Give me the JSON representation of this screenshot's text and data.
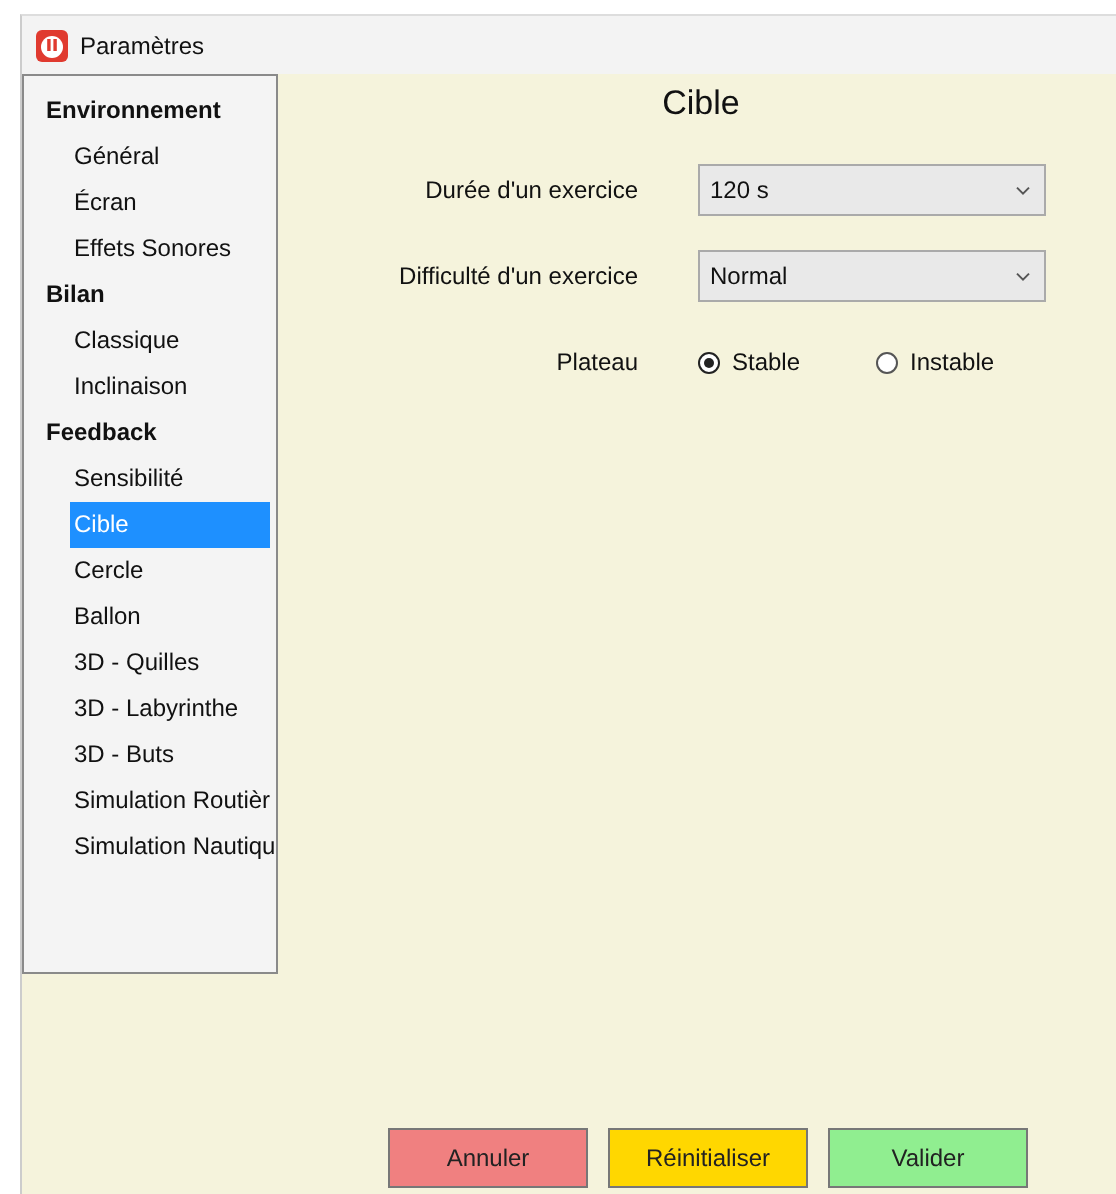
{
  "window": {
    "title": "Paramètres"
  },
  "sidebar": {
    "groups": [
      {
        "label": "Environnement",
        "items": [
          {
            "label": "Général",
            "selected": false
          },
          {
            "label": "Écran",
            "selected": false
          },
          {
            "label": "Effets Sonores",
            "selected": false
          }
        ]
      },
      {
        "label": "Bilan",
        "items": [
          {
            "label": "Classique",
            "selected": false
          },
          {
            "label": "Inclinaison",
            "selected": false
          }
        ]
      },
      {
        "label": "Feedback",
        "items": [
          {
            "label": "Sensibilité",
            "selected": false
          },
          {
            "label": "Cible",
            "selected": true
          },
          {
            "label": "Cercle",
            "selected": false
          },
          {
            "label": "Ballon",
            "selected": false
          },
          {
            "label": "3D - Quilles",
            "selected": false
          },
          {
            "label": "3D - Labyrinthe",
            "selected": false
          },
          {
            "label": "3D - Buts",
            "selected": false
          },
          {
            "label": "Simulation Routièr",
            "selected": false
          },
          {
            "label": "Simulation Nautiqu",
            "selected": false
          }
        ]
      }
    ]
  },
  "panel": {
    "title": "Cible",
    "fields": [
      {
        "kind": "dropdown",
        "label": "Durée d'un exercice",
        "value": "120 s"
      },
      {
        "kind": "dropdown",
        "label": "Difficulté d'un exercice",
        "value": "Normal"
      },
      {
        "kind": "radio",
        "label": "Plateau",
        "options": [
          {
            "label": "Stable",
            "selected": true
          },
          {
            "label": "Instable",
            "selected": false
          }
        ]
      }
    ]
  },
  "buttons": [
    {
      "label": "Annuler",
      "color": "#f08080"
    },
    {
      "label": "Réinitialiser",
      "color": "#ffd700"
    },
    {
      "label": "Valider",
      "color": "#90ee90"
    }
  ]
}
